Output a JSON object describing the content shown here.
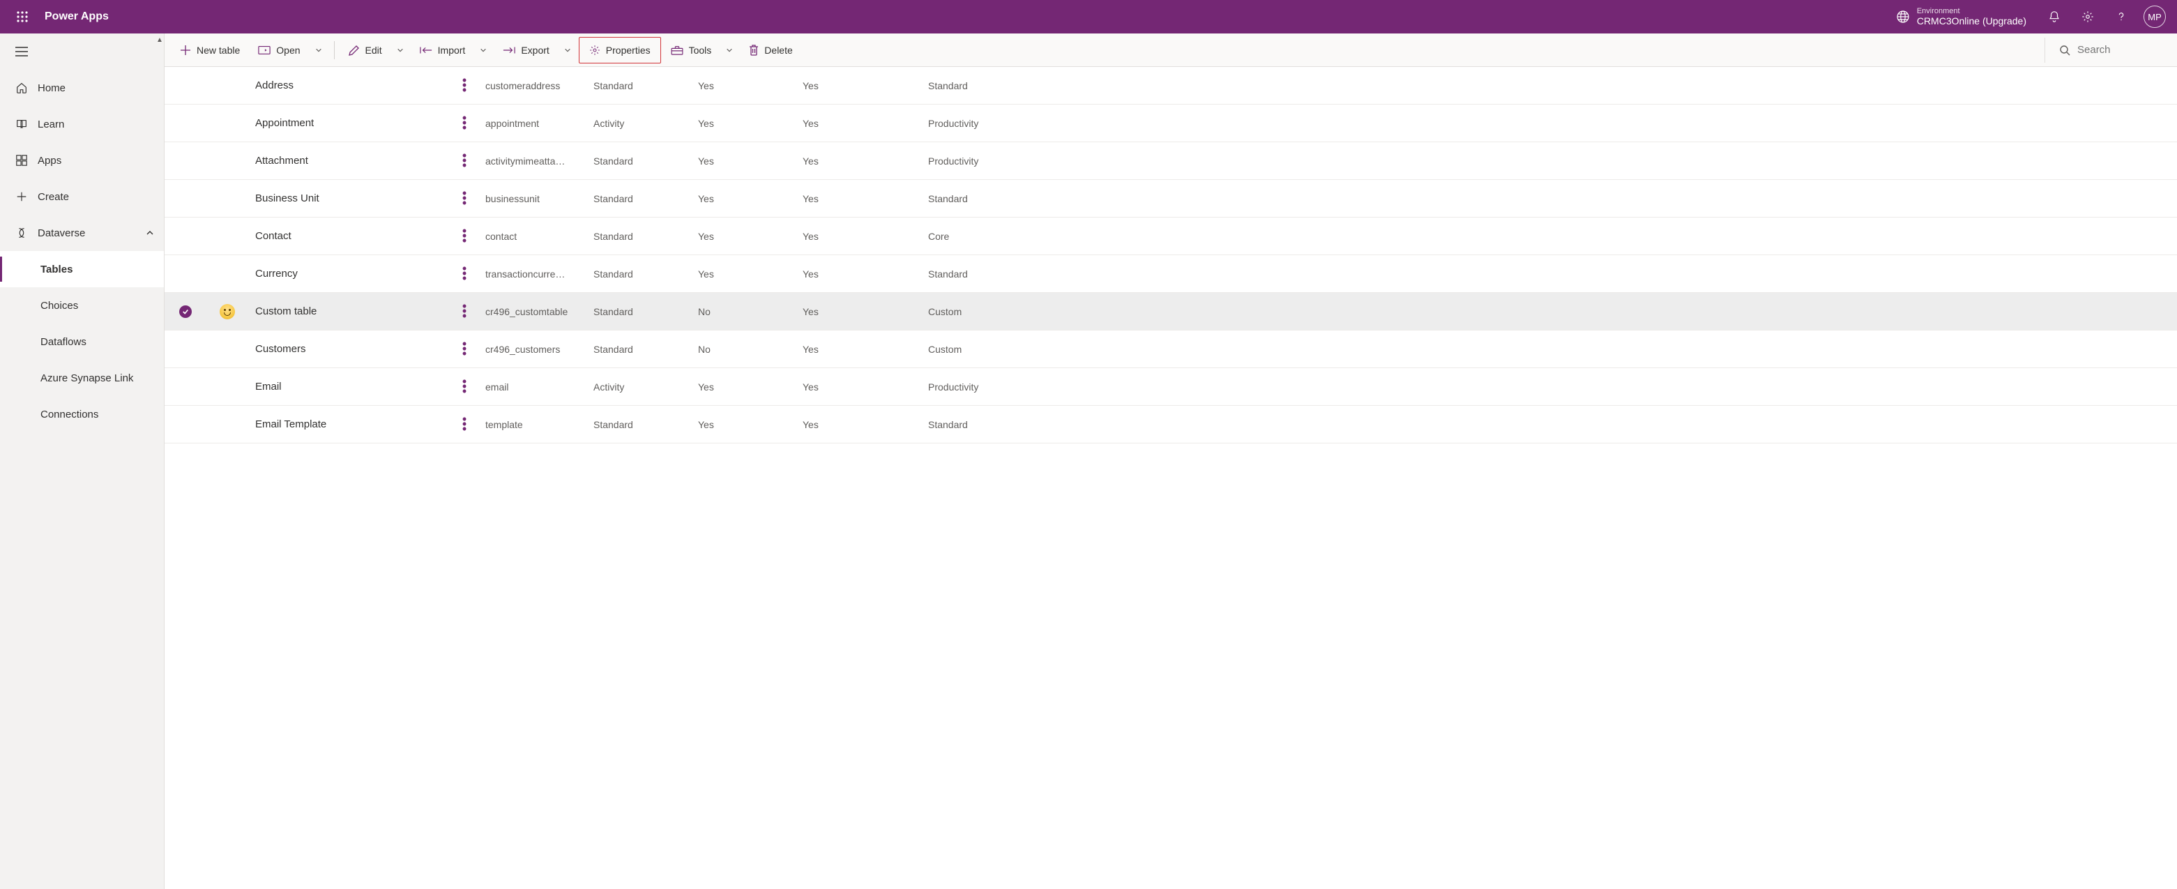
{
  "brandColor": "#742774",
  "header": {
    "appTitle": "Power Apps",
    "environment": {
      "label": "Environment",
      "value": "CRMC3Online (Upgrade)"
    },
    "avatarInitials": "MP"
  },
  "sidebar": {
    "items": [
      {
        "id": "home",
        "label": "Home",
        "icon": "home"
      },
      {
        "id": "learn",
        "label": "Learn",
        "icon": "book"
      },
      {
        "id": "apps",
        "label": "Apps",
        "icon": "grid"
      },
      {
        "id": "create",
        "label": "Create",
        "icon": "plus"
      },
      {
        "id": "dataverse",
        "label": "Dataverse",
        "icon": "dataverse",
        "hasChildren": true,
        "expanded": true,
        "children": [
          {
            "id": "tables",
            "label": "Tables",
            "selected": true
          },
          {
            "id": "choices",
            "label": "Choices"
          },
          {
            "id": "dataflows",
            "label": "Dataflows"
          },
          {
            "id": "synapse",
            "label": "Azure Synapse Link"
          },
          {
            "id": "connections",
            "label": "Connections"
          }
        ]
      }
    ]
  },
  "toolbar": {
    "newTable": "New table",
    "open": "Open",
    "edit": "Edit",
    "import": "Import",
    "export": "Export",
    "properties": "Properties",
    "tools": "Tools",
    "delete": "Delete",
    "searchPlaceholder": "Search"
  },
  "tables": [
    {
      "display": "Address",
      "name": "customeraddress",
      "type": "Standard",
      "managed": "Yes",
      "customizable": "Yes",
      "tags": "Standard"
    },
    {
      "display": "Appointment",
      "name": "appointment",
      "type": "Activity",
      "managed": "Yes",
      "customizable": "Yes",
      "tags": "Productivity"
    },
    {
      "display": "Attachment",
      "name": "activitymimeatta…",
      "type": "Standard",
      "managed": "Yes",
      "customizable": "Yes",
      "tags": "Productivity"
    },
    {
      "display": "Business Unit",
      "name": "businessunit",
      "type": "Standard",
      "managed": "Yes",
      "customizable": "Yes",
      "tags": "Standard"
    },
    {
      "display": "Contact",
      "name": "contact",
      "type": "Standard",
      "managed": "Yes",
      "customizable": "Yes",
      "tags": "Core"
    },
    {
      "display": "Currency",
      "name": "transactioncurre…",
      "type": "Standard",
      "managed": "Yes",
      "customizable": "Yes",
      "tags": "Standard"
    },
    {
      "display": "Custom table",
      "name": "cr496_customtable",
      "type": "Standard",
      "managed": "No",
      "customizable": "Yes",
      "tags": "Custom",
      "selected": true,
      "icon": "smiley"
    },
    {
      "display": "Customers",
      "name": "cr496_customers",
      "type": "Standard",
      "managed": "No",
      "customizable": "Yes",
      "tags": "Custom"
    },
    {
      "display": "Email",
      "name": "email",
      "type": "Activity",
      "managed": "Yes",
      "customizable": "Yes",
      "tags": "Productivity"
    },
    {
      "display": "Email Template",
      "name": "template",
      "type": "Standard",
      "managed": "Yes",
      "customizable": "Yes",
      "tags": "Standard"
    }
  ]
}
